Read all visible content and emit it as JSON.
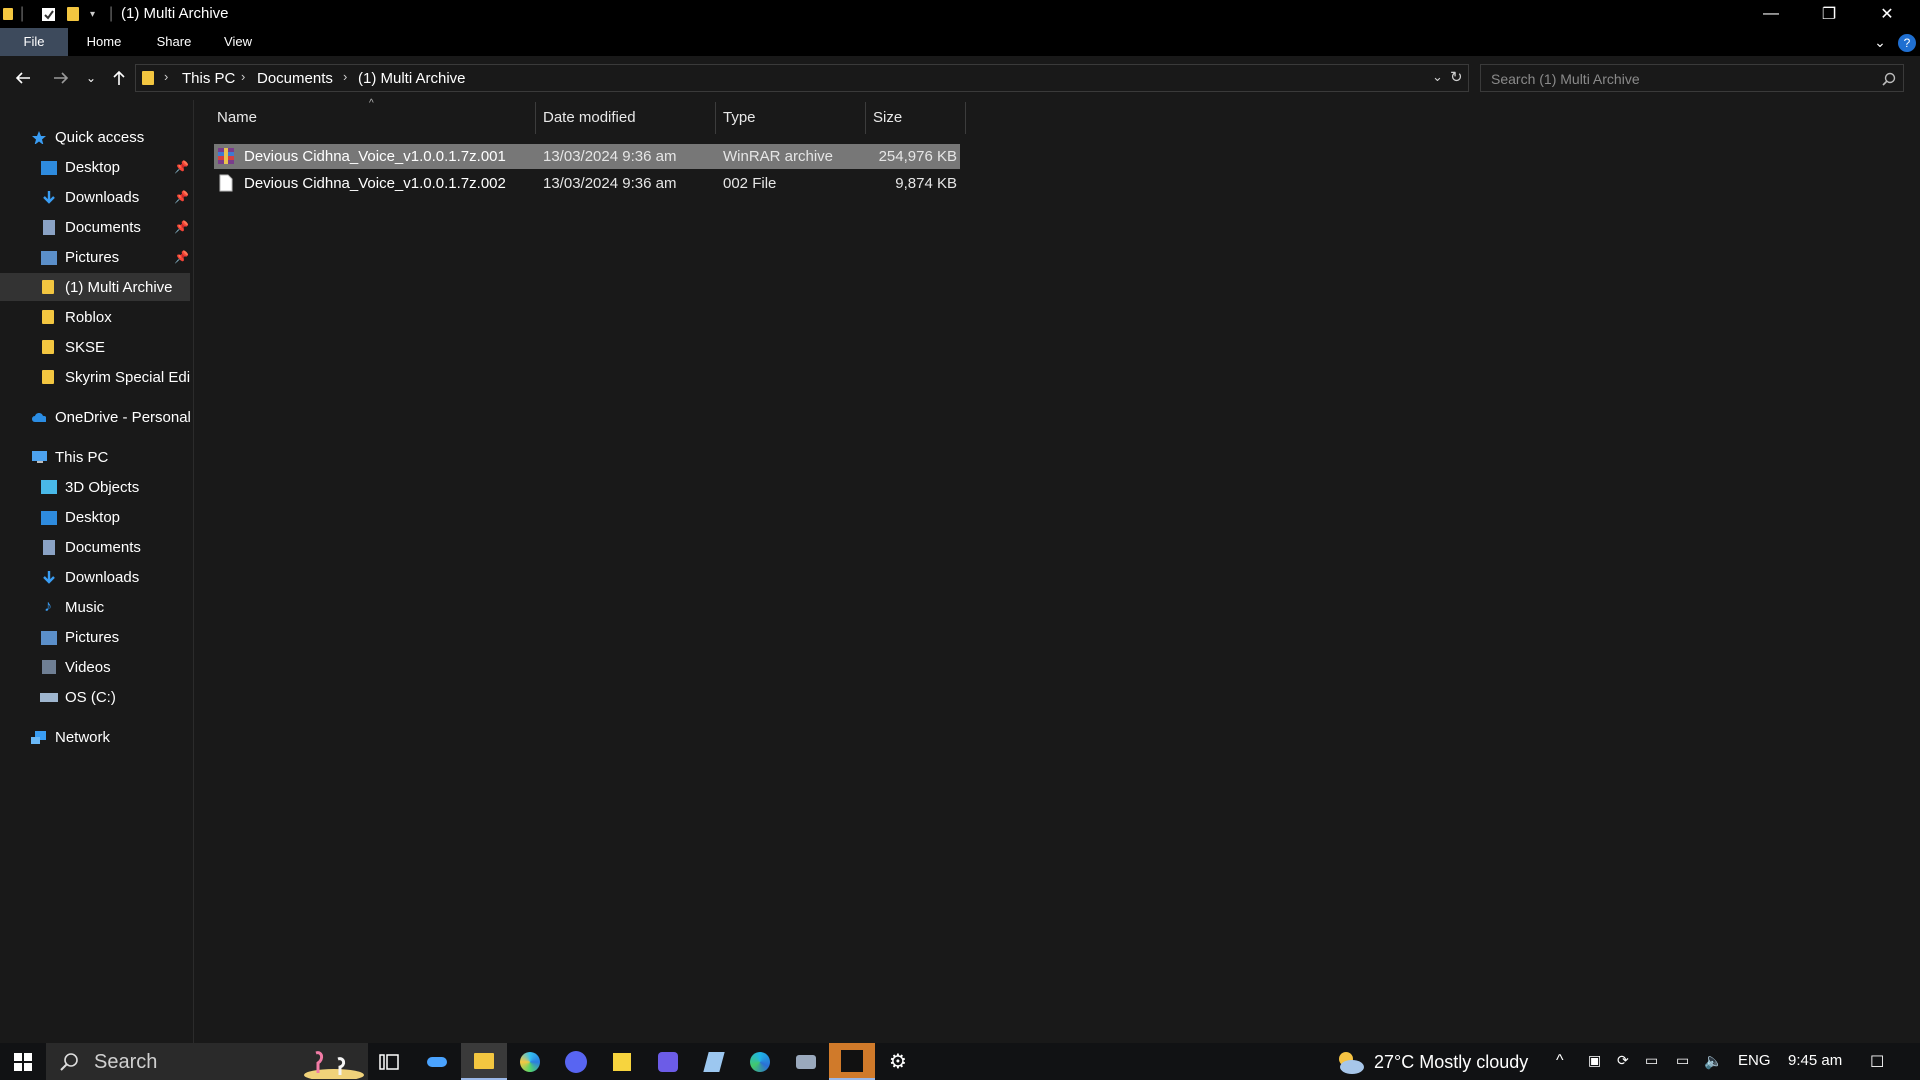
{
  "window": {
    "title": "(1) Multi Archive",
    "minimize_glyph": "—",
    "maximize_glyph": "❐",
    "close_glyph": "✕"
  },
  "ribbon": {
    "tabs": [
      "File",
      "Home",
      "Share",
      "View"
    ],
    "help_glyph": "?"
  },
  "address": {
    "crumbs": [
      "This PC",
      "Documents",
      "(1) Multi Archive"
    ],
    "search_placeholder": "Search (1) Multi Archive"
  },
  "nav": {
    "quick_access": "Quick access",
    "quick_items": [
      "Desktop",
      "Downloads",
      "Documents",
      "Pictures",
      "(1) Multi Archive",
      "Roblox",
      "SKSE",
      "Skyrim Special Edition"
    ],
    "onedrive": "OneDrive - Personal",
    "this_pc": "This PC",
    "pc_items": [
      "3D Objects",
      "Desktop",
      "Documents",
      "Downloads",
      "Music",
      "Pictures",
      "Videos",
      "OS (C:)"
    ],
    "network": "Network",
    "selected": "(1) Multi Archive"
  },
  "columns": [
    "Name",
    "Date modified",
    "Type",
    "Size"
  ],
  "files": [
    {
      "name": "Devious Cidhna_Voice_v1.0.0.1.7z.001",
      "date": "13/03/2024 9:36 am",
      "type": "WinRAR archive",
      "size": "254,976 KB",
      "icon": "winrar-archive-icon",
      "selected": true
    },
    {
      "name": "Devious Cidhna_Voice_v1.0.0.1.7z.002",
      "date": "13/03/2024 9:36 am",
      "type": "002 File",
      "size": "9,874 KB",
      "icon": "blank-file-icon",
      "selected": false
    }
  ],
  "taskbar": {
    "search_label": "Search",
    "weather": "27°C  Mostly cloudy",
    "language": "ENG",
    "time": "9:45 am",
    "apps": [
      "task-view-icon",
      "tuner-app-icon",
      "file-explorer-icon",
      "edge-browser-icon",
      "discord-icon",
      "sticky-notes-icon",
      "wakelet-icon",
      "feather-app-icon",
      "edge-icon",
      "camera-icon",
      "game-app-icon",
      "settings-icon"
    ]
  },
  "colors": {
    "background": "#191919",
    "selected_row": "#777777",
    "file_tab": "#3d4a5c",
    "folder": "#f3c640",
    "accent_blue": "#4aa3ff"
  }
}
